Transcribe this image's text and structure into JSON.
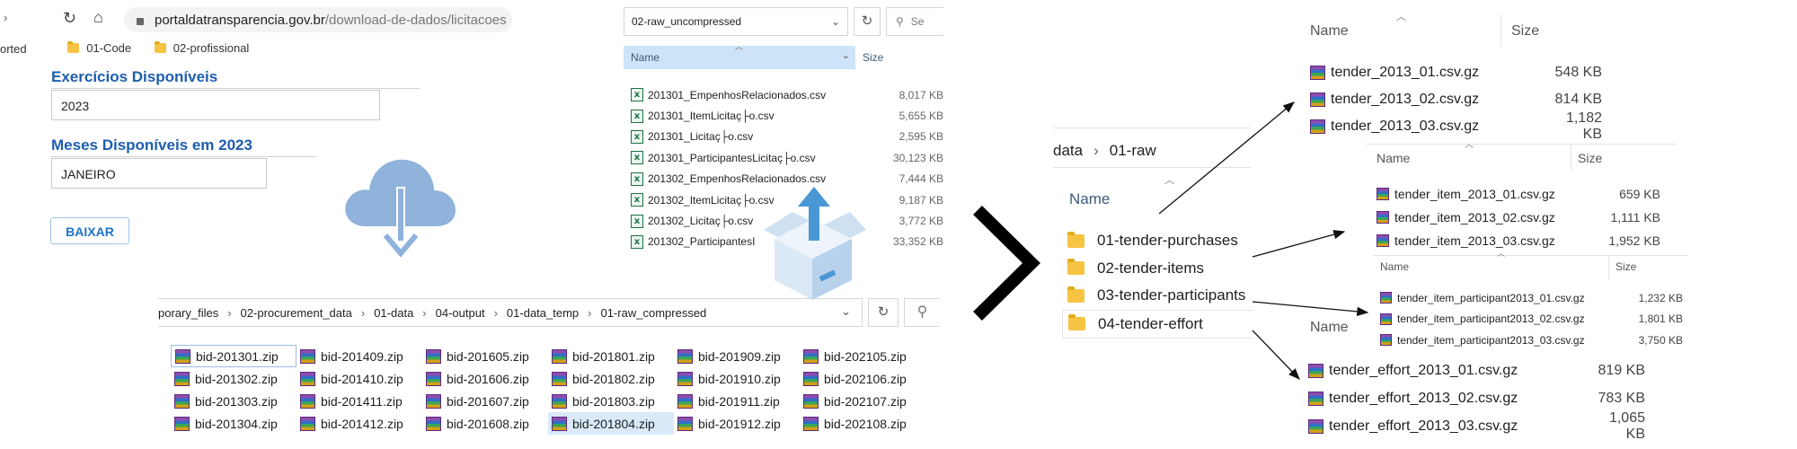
{
  "browser": {
    "url_domain": "portaldatransparencia.gov.br",
    "url_path": "/download-de-dados/licitacoes",
    "bookmarks": [
      "orted",
      "01-Code",
      "02-profissional"
    ]
  },
  "form": {
    "years_label": "Exercícios Disponíveis",
    "year_value": "2023",
    "months_label": "Meses Disponíveis em 2023",
    "month_value": "JANEIRO",
    "download_button": "BAIXAR"
  },
  "raw_panel": {
    "address": "02-raw_uncompressed",
    "search_placeholder": "Se",
    "col_name": "Name",
    "col_size": "Size",
    "files": [
      {
        "name": "201301_EmpenhosRelacionados.csv",
        "size": "8,017 KB"
      },
      {
        "name": "201301_ItemLicitaç├o.csv",
        "size": "5,655 KB"
      },
      {
        "name": "201301_Licitaç├o.csv",
        "size": "2,595 KB"
      },
      {
        "name": "201301_ParticipantesLicitaç├o.csv",
        "size": "30,123 KB"
      },
      {
        "name": "201302_EmpenhosRelacionados.csv",
        "size": "7,444 KB"
      },
      {
        "name": "201302_ItemLicitaç├o.csv",
        "size": "9,187 KB"
      },
      {
        "name": "201302_Licitaç├o.csv",
        "size": "3,772 KB"
      },
      {
        "name": "201302_ParticipantesI",
        "size": "33,352 KB"
      }
    ]
  },
  "compressed_panel": {
    "breadcrumb": [
      "porary_files",
      "02-procurement_data",
      "01-data",
      "04-output",
      "01-data_temp",
      "01-raw_compressed"
    ],
    "zips": [
      [
        "bid-201301.zip",
        "bid-201409.zip",
        "bid-201605.zip",
        "bid-201801.zip",
        "bid-201909.zip",
        "bid-202105.zip"
      ],
      [
        "bid-201302.zip",
        "bid-201410.zip",
        "bid-201606.zip",
        "bid-201802.zip",
        "bid-201910.zip",
        "bid-202106.zip"
      ],
      [
        "bid-201303.zip",
        "bid-201411.zip",
        "bid-201607.zip",
        "bid-201803.zip",
        "bid-201911.zip",
        "bid-202107.zip"
      ],
      [
        "bid-201304.zip",
        "bid-201412.zip",
        "bid-201608.zip",
        "bid-201804.zip",
        "bid-201912.zip",
        "bid-202108.zip"
      ]
    ]
  },
  "raw_folder": {
    "breadcrumb": [
      "data",
      "01-raw"
    ],
    "col_name": "Name",
    "folders": [
      "01-tender-purchases",
      "02-tender-items",
      "03-tender-participants",
      "04-tender-effort"
    ]
  },
  "purchases_files": {
    "col_name": "Name",
    "col_size": "Size",
    "files": [
      {
        "name": "tender_2013_01.csv.gz",
        "size": "548 KB"
      },
      {
        "name": "tender_2013_02.csv.gz",
        "size": "814 KB"
      },
      {
        "name": "tender_2013_03.csv.gz",
        "size": "1,182 KB"
      }
    ]
  },
  "items_files": {
    "col_name": "Name",
    "col_size": "Size",
    "files": [
      {
        "name": "tender_item_2013_01.csv.gz",
        "size": "659 KB"
      },
      {
        "name": "tender_item_2013_02.csv.gz",
        "size": "1,111 KB"
      },
      {
        "name": "tender_item_2013_03.csv.gz",
        "size": "1,952 KB"
      }
    ]
  },
  "participants_files": {
    "col_name": "Name",
    "col_size": "Size",
    "files": [
      {
        "name": "tender_item_participant2013_01.csv.gz",
        "size": "1,232 KB"
      },
      {
        "name": "tender_item_participant2013_02.csv.gz",
        "size": "1,801 KB"
      },
      {
        "name": "tender_item_participant2013_03.csv.gz",
        "size": "3,750 KB"
      }
    ]
  },
  "effort_files": {
    "col_name": "Name",
    "files": [
      {
        "name": "tender_effort_2013_01.csv.gz",
        "size": "819 KB"
      },
      {
        "name": "tender_effort_2013_02.csv.gz",
        "size": "783 KB"
      },
      {
        "name": "tender_effort_2013_03.csv.gz",
        "size": "1,065 KB"
      }
    ]
  }
}
